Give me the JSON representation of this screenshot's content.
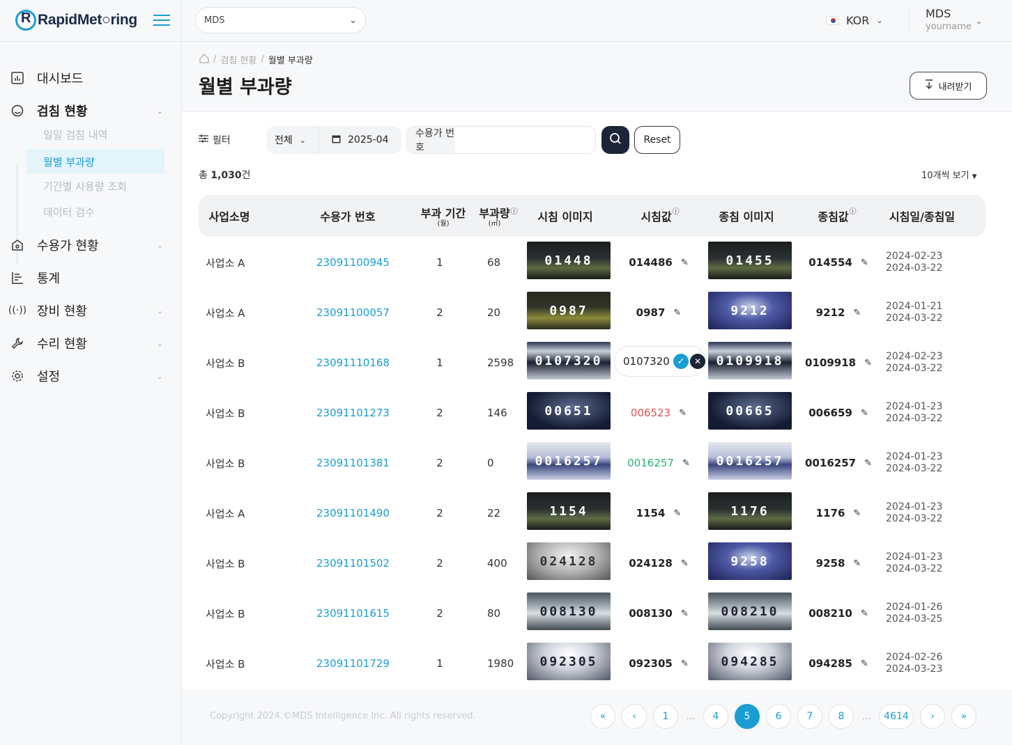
{
  "brand": {
    "logo_text": "RapidMet○ring"
  },
  "header": {
    "org_select": "MDS",
    "lang": "KOR",
    "user_name": "MDS",
    "user_sub": "yourname"
  },
  "sidebar": {
    "items": [
      {
        "label": "대시보드",
        "icon": "dashboard-icon"
      },
      {
        "label": "검침 현황",
        "icon": "meter-reading-icon"
      },
      {
        "label": "수용가 현황",
        "icon": "customer-icon"
      },
      {
        "label": "통계",
        "icon": "chart-icon"
      },
      {
        "label": "장비 현황",
        "icon": "device-icon"
      },
      {
        "label": "수리 현황",
        "icon": "wrench-icon"
      },
      {
        "label": "설정",
        "icon": "gear-icon"
      }
    ],
    "sub": [
      "일일 검침 내역",
      "월별 부과량",
      "기간별 사용량 조회",
      "데이터 검수"
    ]
  },
  "breadcrumb": {
    "parent": "검침 현황",
    "current": "월별 부과량"
  },
  "page": {
    "title": "월별 부과량",
    "download": "내려받기"
  },
  "filter": {
    "label": "필터",
    "scope": "전체",
    "month": "2025-04",
    "search_label": "수용가 번호",
    "search_value": "",
    "reset": "Reset"
  },
  "summary": {
    "prefix": "총",
    "count": "1,030",
    "suffix": "건",
    "per_page": "10개씩 보기"
  },
  "columns": {
    "site": "사업소명",
    "customer": "수용가 번호",
    "period": "부과 기간",
    "period_unit": "(월)",
    "usage": "부과량",
    "usage_unit": "(㎥)",
    "start_img": "시침 이미지",
    "start_val": "시침값",
    "end_img": "종침 이미지",
    "end_val": "종침값",
    "dates": "시침일/종침일"
  },
  "rows": [
    {
      "site": "사업소 A",
      "customer": "23091100945",
      "period": "1",
      "usage": "68",
      "start_reading": "014486",
      "end_reading": "014554",
      "start_date": "2024-02-23",
      "end_date": "2024-03-22",
      "start_meter": "01448",
      "end_meter": "01455"
    },
    {
      "site": "사업소 A",
      "customer": "23091100057",
      "period": "2",
      "usage": "20",
      "start_reading": "0987",
      "end_reading": "9212",
      "start_date": "2024-01-21",
      "end_date": "2024-03-22",
      "start_meter": "0987",
      "end_meter": "9212"
    },
    {
      "site": "사업소 B",
      "customer": "23091110168",
      "period": "1",
      "usage": "2598",
      "start_reading": "0107320",
      "end_reading": "0109918",
      "start_date": "2024-02-23",
      "end_date": "2024-03-22",
      "start_meter": "0107320",
      "end_meter": "0109918"
    },
    {
      "site": "사업소 B",
      "customer": "23091101273",
      "period": "2",
      "usage": "146",
      "start_reading": "006523",
      "end_reading": "006659",
      "start_date": "2024-01-23",
      "end_date": "2024-03-22",
      "start_meter": "00651",
      "end_meter": "00665"
    },
    {
      "site": "사업소 B",
      "customer": "23091101381",
      "period": "2",
      "usage": "0",
      "start_reading": "0016257",
      "end_reading": "0016257",
      "start_date": "2024-01-23",
      "end_date": "2024-03-22",
      "start_meter": "0016257",
      "end_meter": "0016257"
    },
    {
      "site": "사업소 A",
      "customer": "23091101490",
      "period": "2",
      "usage": "22",
      "start_reading": "1154",
      "end_reading": "1176",
      "start_date": "2024-01-23",
      "end_date": "2024-03-22",
      "start_meter": "1154",
      "end_meter": "1176"
    },
    {
      "site": "사업소 B",
      "customer": "23091101502",
      "period": "2",
      "usage": "400",
      "start_reading": "024128",
      "end_reading": "9258",
      "start_date": "2024-01-23",
      "end_date": "2024-03-22",
      "start_meter": "024128",
      "end_meter": "9258"
    },
    {
      "site": "사업소 B",
      "customer": "23091101615",
      "period": "2",
      "usage": "80",
      "start_reading": "008130",
      "end_reading": "008210",
      "start_date": "2024-01-26",
      "end_date": "2024-03-25",
      "start_meter": "008130",
      "end_meter": "008210"
    },
    {
      "site": "사업소 B",
      "customer": "23091101729",
      "period": "1",
      "usage": "1980",
      "start_reading": "092305",
      "end_reading": "094285",
      "start_date": "2024-02-26",
      "end_date": "2024-03-23",
      "start_meter": "092305",
      "end_meter": "094285"
    }
  ],
  "footer": {
    "copyright": "Copyright 2024.©MDS Intelligence Inc. All rights reserved."
  },
  "pagination": {
    "first": "«",
    "prev": "‹",
    "pages": [
      "1",
      "4",
      "5",
      "6",
      "7",
      "8",
      "4614"
    ],
    "next": "›",
    "last": "»",
    "ellipsis": "..."
  }
}
